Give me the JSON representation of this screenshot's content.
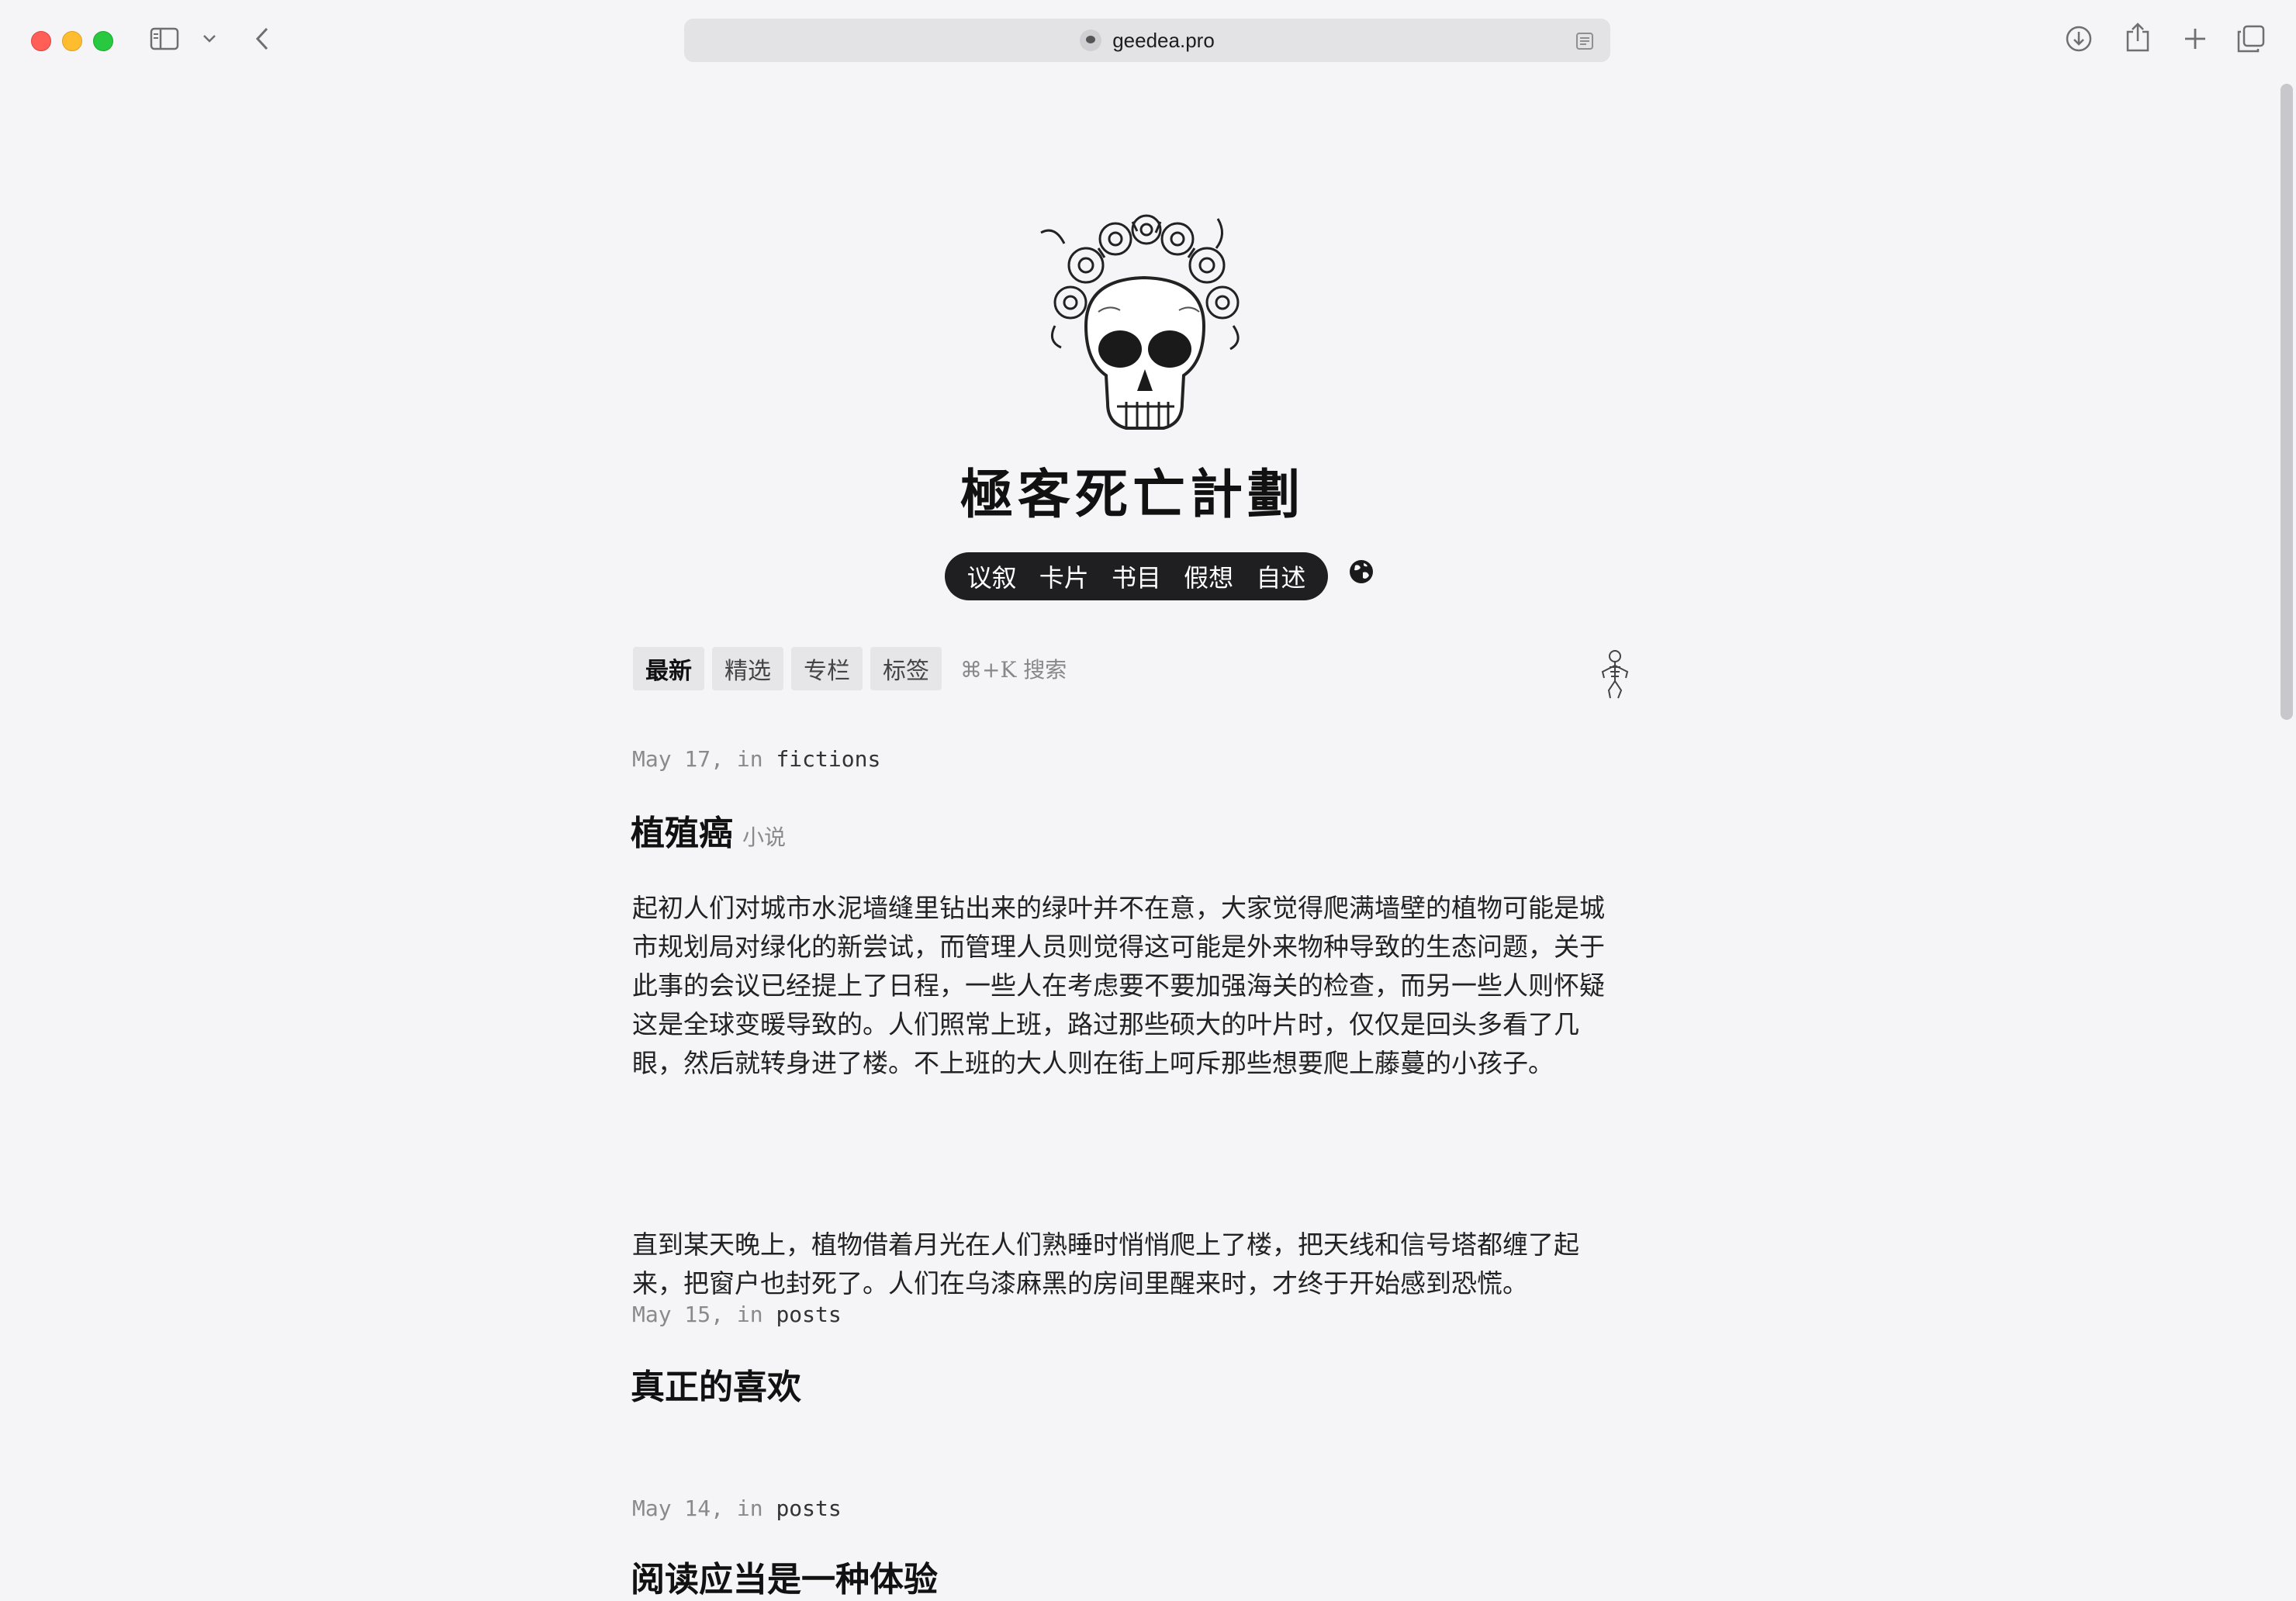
{
  "browser": {
    "url": "geedea.pro",
    "accent_close": "#ff5f57",
    "accent_minimize": "#febc2e",
    "accent_zoom": "#28c840",
    "icons": [
      "sidebar-icon",
      "chevron-down-icon",
      "back-icon",
      "reader-icon",
      "download-icon",
      "share-icon",
      "new-tab-icon",
      "tab-overview-icon"
    ]
  },
  "site": {
    "title": "極客死亡計劃",
    "logo_icon": "flower-skull-icon",
    "nav": [
      "议叙",
      "卡片",
      "书目",
      "假想",
      "自述"
    ],
    "globe_icon": "globe-icon"
  },
  "tabs": {
    "items": [
      "最新",
      "精选",
      "专栏",
      "标签"
    ],
    "active": "最新",
    "search_hint": "⌘+K 搜索",
    "mascot_icon": "skeleton-icon"
  },
  "posts": [
    {
      "date": "May 17,",
      "in": "in",
      "category": "fictions",
      "title": "植殖癌",
      "tag": "小说",
      "paragraphs": [
        "起初人们对城市水泥墙缝里钻出来的绿叶并不在意，大家觉得爬满墙壁的植物可能是城市规划局对绿化的新尝试，而管理人员则觉得这可能是外来物种导致的生态问题，关于此事的会议已经提上了日程，一些人在考虑要不要加强海关的检查，而另一些人则怀疑这是全球变暖导致的。人们照常上班，路过那些硕大的叶片时，仅仅是回头多看了几眼，然后就转身进了楼。不上班的大人则在街上呵斥那些想要爬上藤蔓的小孩子。",
        "直到某天晚上，植物借着月光在人们熟睡时悄悄爬上了楼，把天线和信号塔都缠了起来，把窗户也封死了。人们在乌漆麻黑的房间里醒来时，才终于开始感到恐慌。"
      ]
    },
    {
      "date": "May 15,",
      "in": "in",
      "category": "posts",
      "title": "真正的喜欢"
    },
    {
      "date": "May 14,",
      "in": "in",
      "category": "posts",
      "title": "阅读应当是一种体验"
    }
  ]
}
